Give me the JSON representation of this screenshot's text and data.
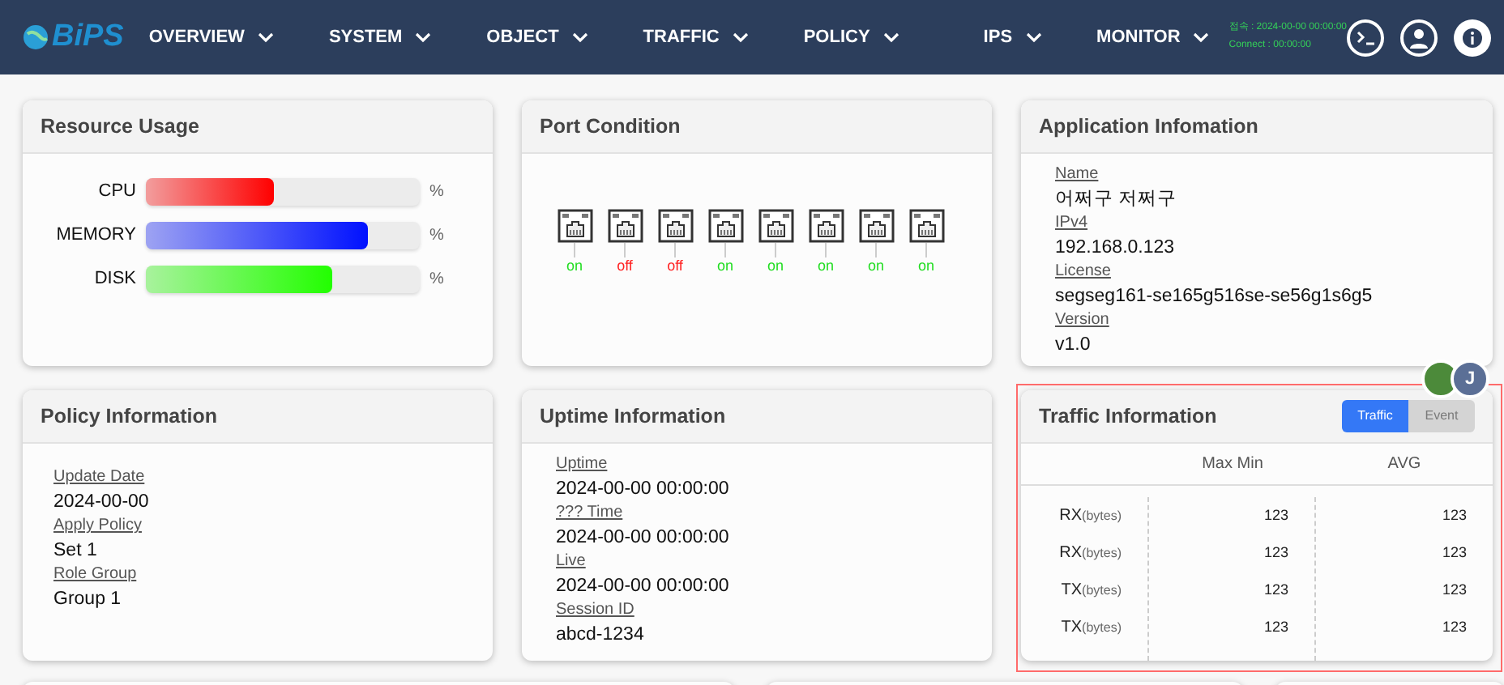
{
  "nav": {
    "logo": "BiPS",
    "menus": [
      {
        "label": "OVERVIEW"
      },
      {
        "label": "SYSTEM"
      },
      {
        "label": "OBJECT"
      },
      {
        "label": "TRAFFIC"
      },
      {
        "label": "POLICY"
      },
      {
        "label": "IPS"
      },
      {
        "label": "MONITOR"
      }
    ],
    "status": {
      "login": "접속 : 2024-00-00 00:00:00",
      "connect": "Connect : 00:00:00"
    }
  },
  "resource": {
    "title": "Resource Usage",
    "unit": "%",
    "bars": [
      {
        "name": "CPU",
        "level": 0.47,
        "color": "#ff0000"
      },
      {
        "name": "MEMORY",
        "level": 0.81,
        "color": "#0011ff"
      },
      {
        "name": "DISK",
        "level": 0.68,
        "color": "#22ff00"
      }
    ]
  },
  "ports": {
    "title": "Port Condition",
    "items": [
      {
        "label": "on",
        "on": true
      },
      {
        "label": "off",
        "on": false
      },
      {
        "label": "off",
        "on": false
      },
      {
        "label": "on",
        "on": true
      },
      {
        "label": "on",
        "on": true
      },
      {
        "label": "on",
        "on": true
      },
      {
        "label": "on",
        "on": true
      },
      {
        "label": "on",
        "on": true
      }
    ]
  },
  "application": {
    "title": "Application Infomation",
    "fields": [
      {
        "label": "Name",
        "value": "어쩌구 저쩌구"
      },
      {
        "label": "IPv4",
        "value": "192.168.0.123"
      },
      {
        "label": "License",
        "value": "segseg161-se165g516se-se56g1s6g5"
      },
      {
        "label": "Version",
        "value": "v1.0"
      }
    ]
  },
  "policy": {
    "title": "Policy Information",
    "fields": [
      {
        "label": "Update Date",
        "value": "2024-00-00"
      },
      {
        "label": "Apply Policy",
        "value": "Set 1"
      },
      {
        "label": "Role Group",
        "value": "Group 1"
      }
    ]
  },
  "uptime": {
    "title": "Uptime Information",
    "fields": [
      {
        "label": "Uptime",
        "value": "2024-00-00 00:00:00"
      },
      {
        "label": "??? Time",
        "value": "2024-00-00 00:00:00"
      },
      {
        "label": "Live",
        "value": "2024-00-00 00:00:00"
      },
      {
        "label": "Session ID",
        "value": "abcd-1234"
      }
    ]
  },
  "traffic": {
    "title": "Traffic Information",
    "selected_outline": true,
    "tabs": [
      {
        "label": "Traffic",
        "selected": true
      },
      {
        "label": "Event",
        "selected": false
      }
    ],
    "avatars": [
      {
        "kind": "picture"
      },
      {
        "kind": "initial",
        "initial": "J"
      }
    ],
    "columns": [
      "Max Min",
      "AVG"
    ],
    "rows": [
      {
        "label": "RX",
        "unit": "(bytes)",
        "values": [
          "123",
          "123"
        ]
      },
      {
        "label": "RX",
        "unit": "(bytes)",
        "values": [
          "123",
          "123"
        ]
      },
      {
        "label": "TX",
        "unit": "(bytes)",
        "values": [
          "123",
          "123"
        ]
      },
      {
        "label": "TX",
        "unit": "(bytes)",
        "values": [
          "123",
          "123"
        ]
      }
    ]
  }
}
